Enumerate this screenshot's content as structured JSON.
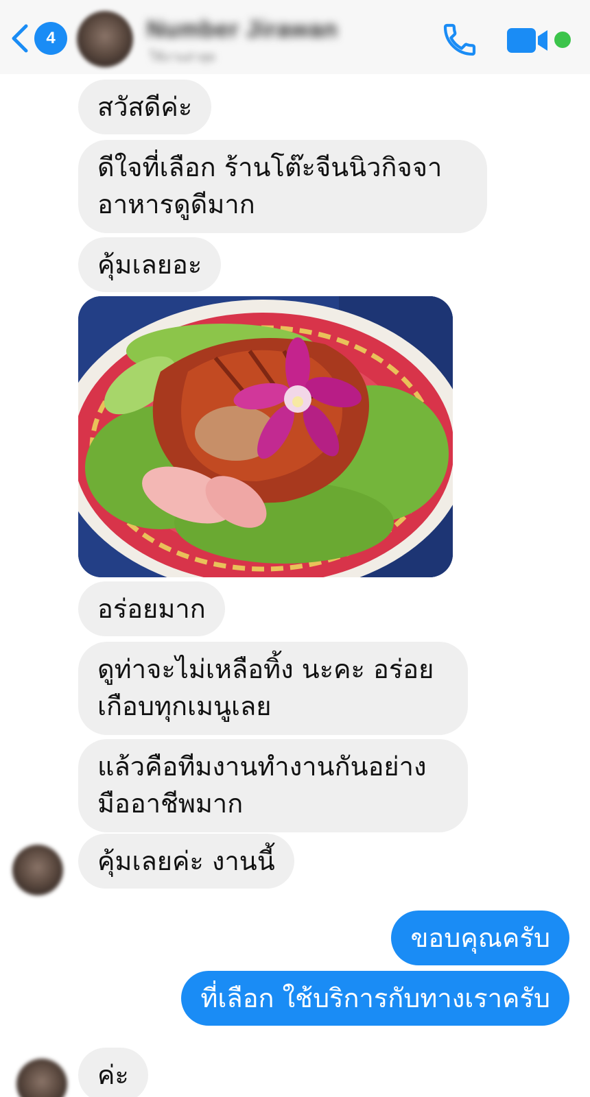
{
  "header": {
    "back_badge": "4",
    "contact_name": "Number Jirawan",
    "contact_status": "ใช้งานล่าสุด"
  },
  "messages": {
    "m1": "สวัสดีค่ะ",
    "m2_l1": "ดีใจที่เลือก ร้านโต๊ะจีนนิวกิจจา",
    "m2_l2": "อาหารดูดีมาก",
    "m3": "คุ้มเลยอะ",
    "m4": "อร่อยมาก",
    "m5_l1": "ดูท่าจะไม่เหลือทิ้ง นะคะ อร่อย",
    "m5_l2": "เกือบทุกเมนูเลย",
    "m6_l1": "แล้วคือทีมงานทำงานกันอย่าง",
    "m6_l2": "มืออาชีพมาก",
    "m7": "คุ้มเลยค่ะ งานนี้",
    "r1": "ขอบคุณครับ",
    "r2": "ที่เลือก ใช้บริการกับทางเราครับ",
    "m8": "ค่ะ"
  },
  "colors": {
    "accent": "#1a8cf5",
    "incoming_bubble": "#efefef",
    "online": "#3cc44b"
  },
  "icons": {
    "back": "chevron-left-icon",
    "call": "phone-icon",
    "video": "video-camera-icon"
  }
}
